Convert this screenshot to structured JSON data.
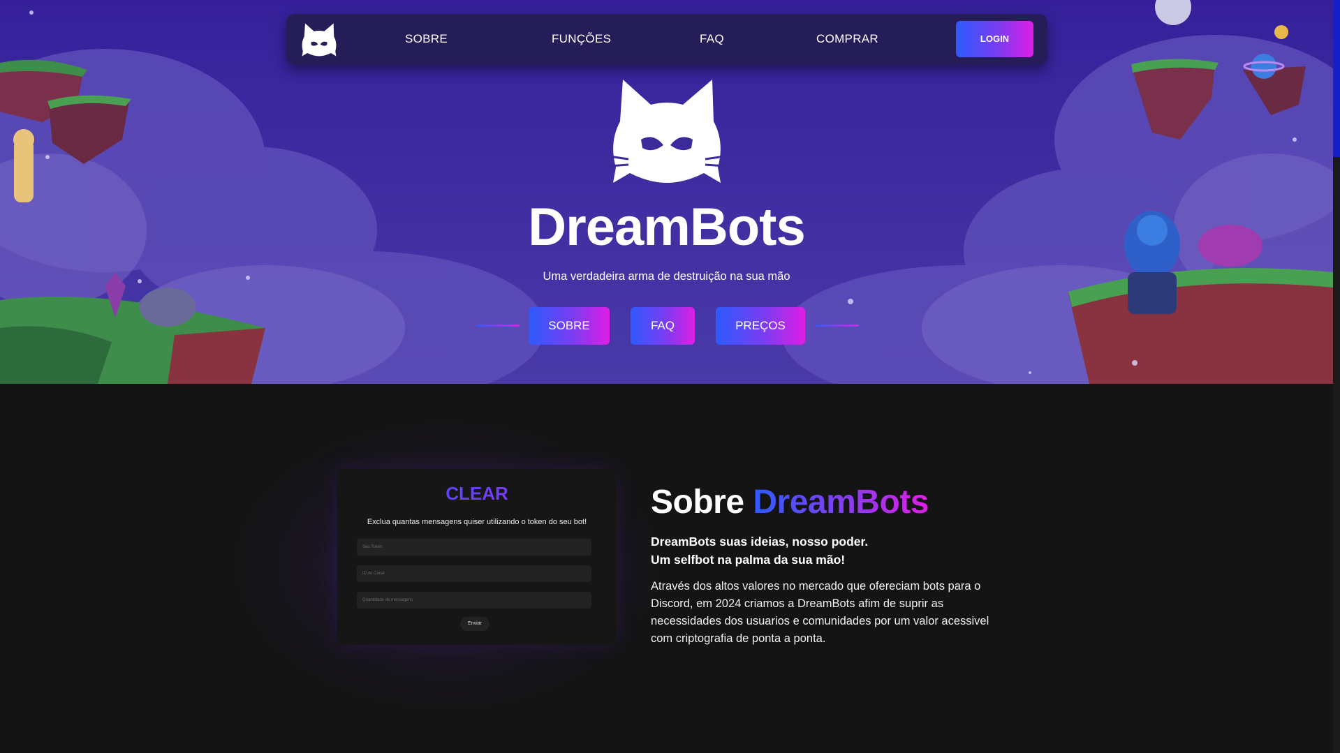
{
  "nav": {
    "logo_icon": "cat-mask-icon",
    "links": [
      "SOBRE",
      "FUNÇÕES",
      "FAQ",
      "COMPRAR"
    ],
    "login_label": "LOGIN"
  },
  "hero": {
    "logo_icon": "cat-mask-icon",
    "brand": "DreamBots",
    "tagline": "Uma verdadeira arma de destruição na sua mão",
    "buttons": [
      "SOBRE",
      "FAQ",
      "PREÇOS"
    ]
  },
  "card": {
    "title": "CLEAR",
    "description": "Exclua quantas mensagens quiser utilizando o token do seu bot!",
    "inputs": [
      "Seu Token",
      "ID do Canal",
      "Quantidade de mensagens"
    ],
    "send_label": "Enviar"
  },
  "about": {
    "title_prefix": "Sobre ",
    "title_brand": "DreamBots",
    "subtitle_line1": "DreamBots suas ideias, nosso poder.",
    "subtitle_line2": "Um selfbot na palma da sua mão!",
    "body": "Através dos altos valores no mercado que ofereciam bots para o Discord, em 2024 criamos a DreamBots afim de suprir as necessidades dos usuarios e comunidades por um valor acessivel com criptografia de ponta a ponta."
  },
  "colors": {
    "hero_bg": "#3a2a9a",
    "page_bg": "#141414",
    "nav_bg": "#251d57",
    "gradient_start": "#2d5bff",
    "gradient_end": "#e01ee6"
  }
}
